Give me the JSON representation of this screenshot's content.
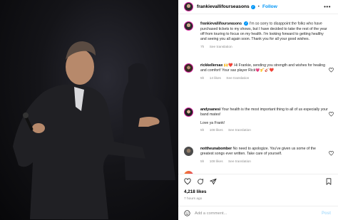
{
  "post": {
    "username": "frankievallifourseasons",
    "follow_label": "Follow",
    "separator": "•",
    "more_label": "•••"
  },
  "comments": [
    {
      "username": "frankievallifourseasons",
      "text": "I'm so sorry to disappoint the folks who have purchased tickets to my shows, but I have decided to take the rest of the year off from touring to focus on my health. I'm looking forward to getting healthy and seeing you all again soon. Thank you for all your good wishes.",
      "time": "7h",
      "translation": "See translation"
    },
    {
      "username": "rickkellersax",
      "text": "🙌❤️ Hi Frankie, sending you strength and wishes for healing and comfort! Your sax player Rick💗🎷🎸❤️",
      "time": "5h",
      "likes": "14 likes",
      "translation": "See translation"
    },
    {
      "username": "andysanesi",
      "text": "Your health is the most important thing to all of us especially your band mates!",
      "text2": "Love ya Frank!",
      "time": "5h",
      "likes": "108 likes",
      "translation": "See translation"
    },
    {
      "username": "nottheunabomber",
      "text": "No need to apologize. You've given us some of the greatest songs ever written. Take care of yourself.",
      "time": "5h",
      "likes": "108 likes",
      "translation": "See translation"
    }
  ],
  "footer": {
    "likes": "4,218 likes",
    "time_ago": "7 hours ago",
    "comment_placeholder": "Add a comment...",
    "post_label": "Post"
  },
  "icons": {
    "like": "heart-icon",
    "comment": "comment-icon",
    "share": "share-icon",
    "save": "bookmark-icon",
    "emoji": "emoji-icon",
    "verified": "verified-badge-icon"
  },
  "colors": {
    "link_blue": "#0095f6",
    "muted_gray": "#8e8e8e",
    "post_disabled": "#b2dffc"
  }
}
